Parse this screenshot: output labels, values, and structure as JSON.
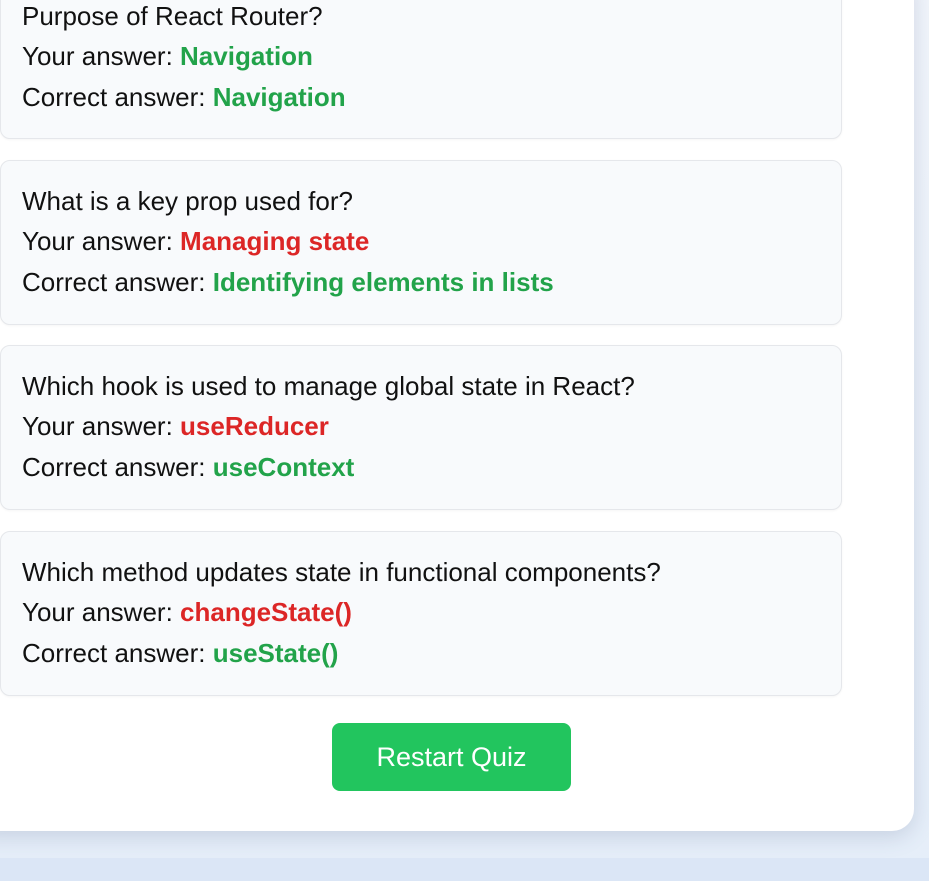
{
  "results": {
    "your_answer_label": "Your answer:",
    "correct_answer_label": "Correct answer:",
    "items": [
      {
        "question": "Purpose of React Router?",
        "your_answer": "Navigation",
        "correct_answer": "Navigation",
        "is_correct": true
      },
      {
        "question": "What is a key prop used for?",
        "your_answer": "Managing state",
        "correct_answer": "Identifying elements in lists",
        "is_correct": false
      },
      {
        "question": "Which hook is used to manage global state in React?",
        "your_answer": "useReducer",
        "correct_answer": "useContext",
        "is_correct": false
      },
      {
        "question": "Which method updates state in functional components?",
        "your_answer": "changeState()",
        "correct_answer": "useState()",
        "is_correct": false
      }
    ]
  },
  "restart_button": {
    "label": "Restart Quiz"
  },
  "colors": {
    "correct": "#22a34a",
    "wrong": "#dc2626",
    "button": "#22c55e"
  }
}
